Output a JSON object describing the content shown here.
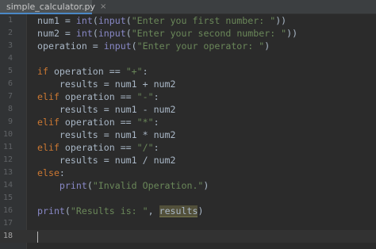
{
  "tab": {
    "filename": "simple_calculator.py",
    "close_glyph": "×"
  },
  "colors": {
    "background": "#2b2b2b",
    "keyword": "#cc7832",
    "string": "#6a8759",
    "builtin": "#8888c6",
    "default_text": "#a9b7c6",
    "line_number": "#606366"
  },
  "lines": [
    {
      "num": "1",
      "indent": "",
      "kw": "",
      "pre": "num1 = ",
      "b1": "int",
      "mid1": "(",
      "b2": "input",
      "mid2": "(",
      "str": "\"Enter you first number: \"",
      "post": "))",
      "hl": "",
      "tail": ""
    },
    {
      "num": "2",
      "indent": "",
      "kw": "",
      "pre": "num2 = ",
      "b1": "int",
      "mid1": "(",
      "b2": "input",
      "mid2": "(",
      "str": "\"Enter your second number: \"",
      "post": "))",
      "hl": "",
      "tail": ""
    },
    {
      "num": "3",
      "indent": "",
      "kw": "",
      "pre": "operation = ",
      "b1": "",
      "mid1": "",
      "b2": "input",
      "mid2": "(",
      "str": "\"Enter your operator: \"",
      "post": ")",
      "hl": "",
      "tail": ""
    },
    {
      "num": "4",
      "indent": "",
      "kw": "",
      "pre": "",
      "b1": "",
      "mid1": "",
      "b2": "",
      "mid2": "",
      "str": "",
      "post": "",
      "hl": "",
      "tail": ""
    },
    {
      "num": "5",
      "indent": "",
      "kw": "if",
      "pre": " operation == ",
      "b1": "",
      "mid1": "",
      "b2": "",
      "mid2": "",
      "str": "\"+\"",
      "post": ":",
      "hl": "",
      "tail": ""
    },
    {
      "num": "6",
      "indent": "    ",
      "kw": "",
      "pre": "results = num1 + num2",
      "b1": "",
      "mid1": "",
      "b2": "",
      "mid2": "",
      "str": "",
      "post": "",
      "hl": "",
      "tail": ""
    },
    {
      "num": "7",
      "indent": "",
      "kw": "elif",
      "pre": " operation == ",
      "b1": "",
      "mid1": "",
      "b2": "",
      "mid2": "",
      "str": "\"-\"",
      "post": ":",
      "hl": "",
      "tail": ""
    },
    {
      "num": "8",
      "indent": "    ",
      "kw": "",
      "pre": "results = num1 - num2",
      "b1": "",
      "mid1": "",
      "b2": "",
      "mid2": "",
      "str": "",
      "post": "",
      "hl": "",
      "tail": ""
    },
    {
      "num": "9",
      "indent": "",
      "kw": "elif",
      "pre": " operation == ",
      "b1": "",
      "mid1": "",
      "b2": "",
      "mid2": "",
      "str": "\"*\"",
      "post": ":",
      "hl": "",
      "tail": ""
    },
    {
      "num": "10",
      "indent": "    ",
      "kw": "",
      "pre": "results = num1 * num2",
      "b1": "",
      "mid1": "",
      "b2": "",
      "mid2": "",
      "str": "",
      "post": "",
      "hl": "",
      "tail": ""
    },
    {
      "num": "11",
      "indent": "",
      "kw": "elif",
      "pre": " operation == ",
      "b1": "",
      "mid1": "",
      "b2": "",
      "mid2": "",
      "str": "\"/\"",
      "post": ":",
      "hl": "",
      "tail": ""
    },
    {
      "num": "12",
      "indent": "    ",
      "kw": "",
      "pre": "results = num1 / num2",
      "b1": "",
      "mid1": "",
      "b2": "",
      "mid2": "",
      "str": "",
      "post": "",
      "hl": "",
      "tail": ""
    },
    {
      "num": "13",
      "indent": "",
      "kw": "else",
      "pre": ":",
      "b1": "",
      "mid1": "",
      "b2": "",
      "mid2": "",
      "str": "",
      "post": "",
      "hl": "",
      "tail": ""
    },
    {
      "num": "14",
      "indent": "    ",
      "kw": "",
      "pre": "",
      "b1": "",
      "mid1": "",
      "b2": "print",
      "mid2": "(",
      "str": "\"Invalid Operation.\"",
      "post": ")",
      "hl": "",
      "tail": ""
    },
    {
      "num": "15",
      "indent": "",
      "kw": "",
      "pre": "",
      "b1": "",
      "mid1": "",
      "b2": "",
      "mid2": "",
      "str": "",
      "post": "",
      "hl": "",
      "tail": ""
    },
    {
      "num": "16",
      "indent": "",
      "kw": "",
      "pre": "",
      "b1": "",
      "mid1": "",
      "b2": "print",
      "mid2": "(",
      "str": "\"Results is: \"",
      "post": ", ",
      "hl": "results",
      "tail": ")"
    },
    {
      "num": "17",
      "indent": "",
      "kw": "",
      "pre": "",
      "b1": "",
      "mid1": "",
      "b2": "",
      "mid2": "",
      "str": "",
      "post": "",
      "hl": "",
      "tail": ""
    },
    {
      "num": "18",
      "indent": "",
      "kw": "",
      "pre": "",
      "b1": "",
      "mid1": "",
      "b2": "",
      "mid2": "",
      "str": "",
      "post": "",
      "hl": "",
      "tail": ""
    }
  ],
  "caret_line": "18"
}
